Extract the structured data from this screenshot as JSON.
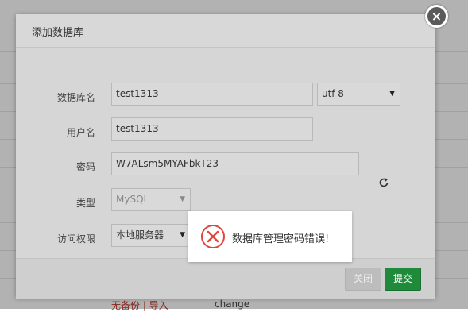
{
  "background": {
    "link_text": "无备份 | 导入",
    "text": "change"
  },
  "dialog": {
    "title": "添加数据库",
    "close_icon": "close-icon",
    "fields": {
      "db_name_label": "数据库名",
      "db_name_value": "test1313",
      "charset_value": "utf-8",
      "user_label": "用户名",
      "user_value": "test1313",
      "password_label": "密码",
      "password_value": "W7ALsm5MYAFbkT23",
      "type_label": "类型",
      "type_value": "MySQL",
      "access_label": "访问权限",
      "access_value": "本地服务器"
    },
    "buttons": {
      "close_label": "关闭",
      "submit_label": "提交"
    }
  },
  "toast": {
    "icon": "error-x-icon",
    "message": "数据库管理密码错误!",
    "accent_color": "#e0453a"
  }
}
